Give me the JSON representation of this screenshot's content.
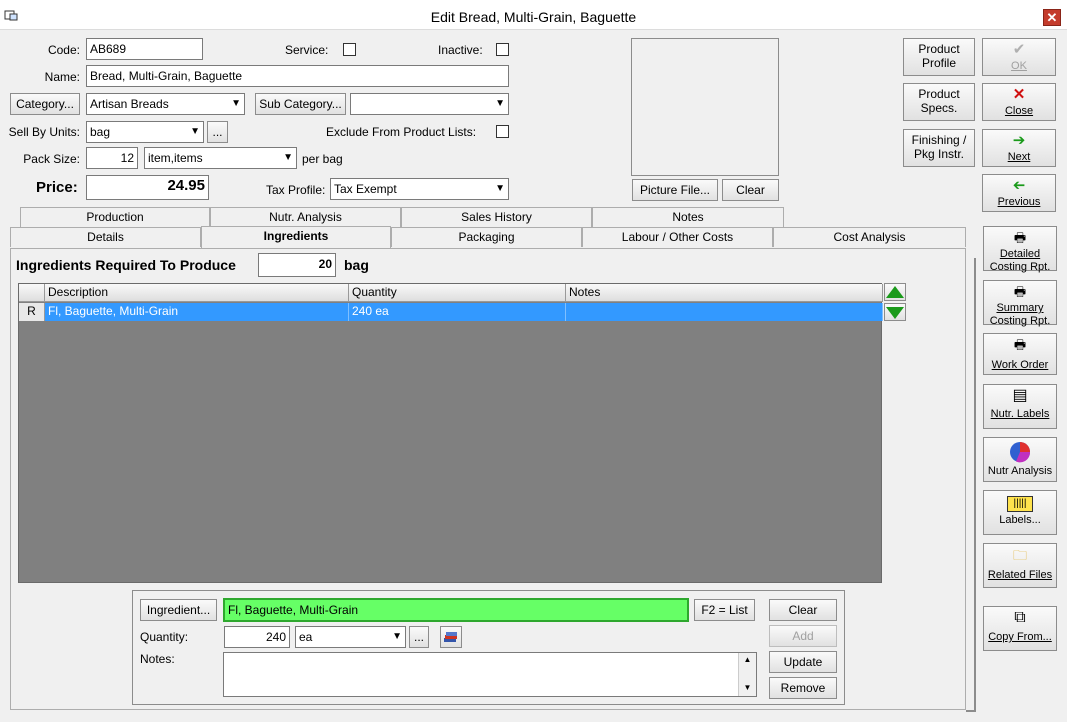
{
  "window": {
    "title": "Edit Bread, Multi-Grain, Baguette",
    "close": "✕"
  },
  "form": {
    "code_label": "Code:",
    "code": "AB689",
    "service_label": "Service:",
    "inactive_label": "Inactive:",
    "name_label": "Name:",
    "name": "Bread, Multi-Grain, Baguette",
    "category_button": "Category...",
    "category": "Artisan Breads",
    "subcategory_button": "Sub Category...",
    "subcategory": "",
    "sell_by_label": "Sell By Units:",
    "sell_by": "bag",
    "ellipsis": "...",
    "exclude_label": "Exclude From Product Lists:",
    "pack_size_label": "Pack Size:",
    "pack_size": "12",
    "pack_unit": "item,items",
    "per_label": "per bag",
    "price_label": "Price:",
    "price": "24.95",
    "tax_label": "Tax Profile:",
    "tax_profile": "Tax Exempt",
    "picture_button": "Picture File...",
    "picture_clear": "Clear"
  },
  "top_buttons": {
    "product_profile": [
      "Product",
      "Profile"
    ],
    "product_specs": [
      "Product",
      "Specs."
    ],
    "finishing": [
      "Finishing /",
      "Pkg Instr."
    ],
    "ok": "OK",
    "close": "Close",
    "next": "Next",
    "previous": "Previous"
  },
  "tabs_back": [
    "Production",
    "Nutr. Analysis",
    "Sales History",
    "Notes"
  ],
  "tabs_front": [
    "Details",
    "Ingredients",
    "Packaging",
    "Labour / Other Costs",
    "Cost Analysis"
  ],
  "ingredients": {
    "required_label": "Ingredients Required To Produce",
    "qty": "20",
    "unit": "bag",
    "columns": [
      "Description",
      "Quantity",
      "Notes"
    ],
    "rows": [
      {
        "marker": "R",
        "description": "Fl, Baguette, Multi-Grain",
        "quantity": "240 ea",
        "notes": ""
      }
    ]
  },
  "editor": {
    "ingredient_button": "Ingredient...",
    "ingredient": "Fl, Baguette, Multi-Grain",
    "f2": "F2 = List",
    "quantity_label": "Quantity:",
    "quantity": "240",
    "unit": "ea",
    "ellipsis": "...",
    "notes_label": "Notes:",
    "notes": "",
    "clear": "Clear",
    "add": "Add",
    "update": "Update",
    "remove": "Remove"
  },
  "side_buttons": {
    "detailed": [
      "Detailed",
      "Costing Rpt."
    ],
    "summary": [
      "Summary",
      "Costing Rpt."
    ],
    "work_order": "Work Order",
    "nutr_labels": "Nutr. Labels",
    "nutr_analysis": "Nutr Analysis",
    "labels": "Labels...",
    "related_files": "Related Files",
    "copy_from": "Copy From..."
  },
  "colors": {
    "highlight_row": "#3399ff",
    "ingredient_field": "#66ff66",
    "close_red": "#c43c2c"
  }
}
